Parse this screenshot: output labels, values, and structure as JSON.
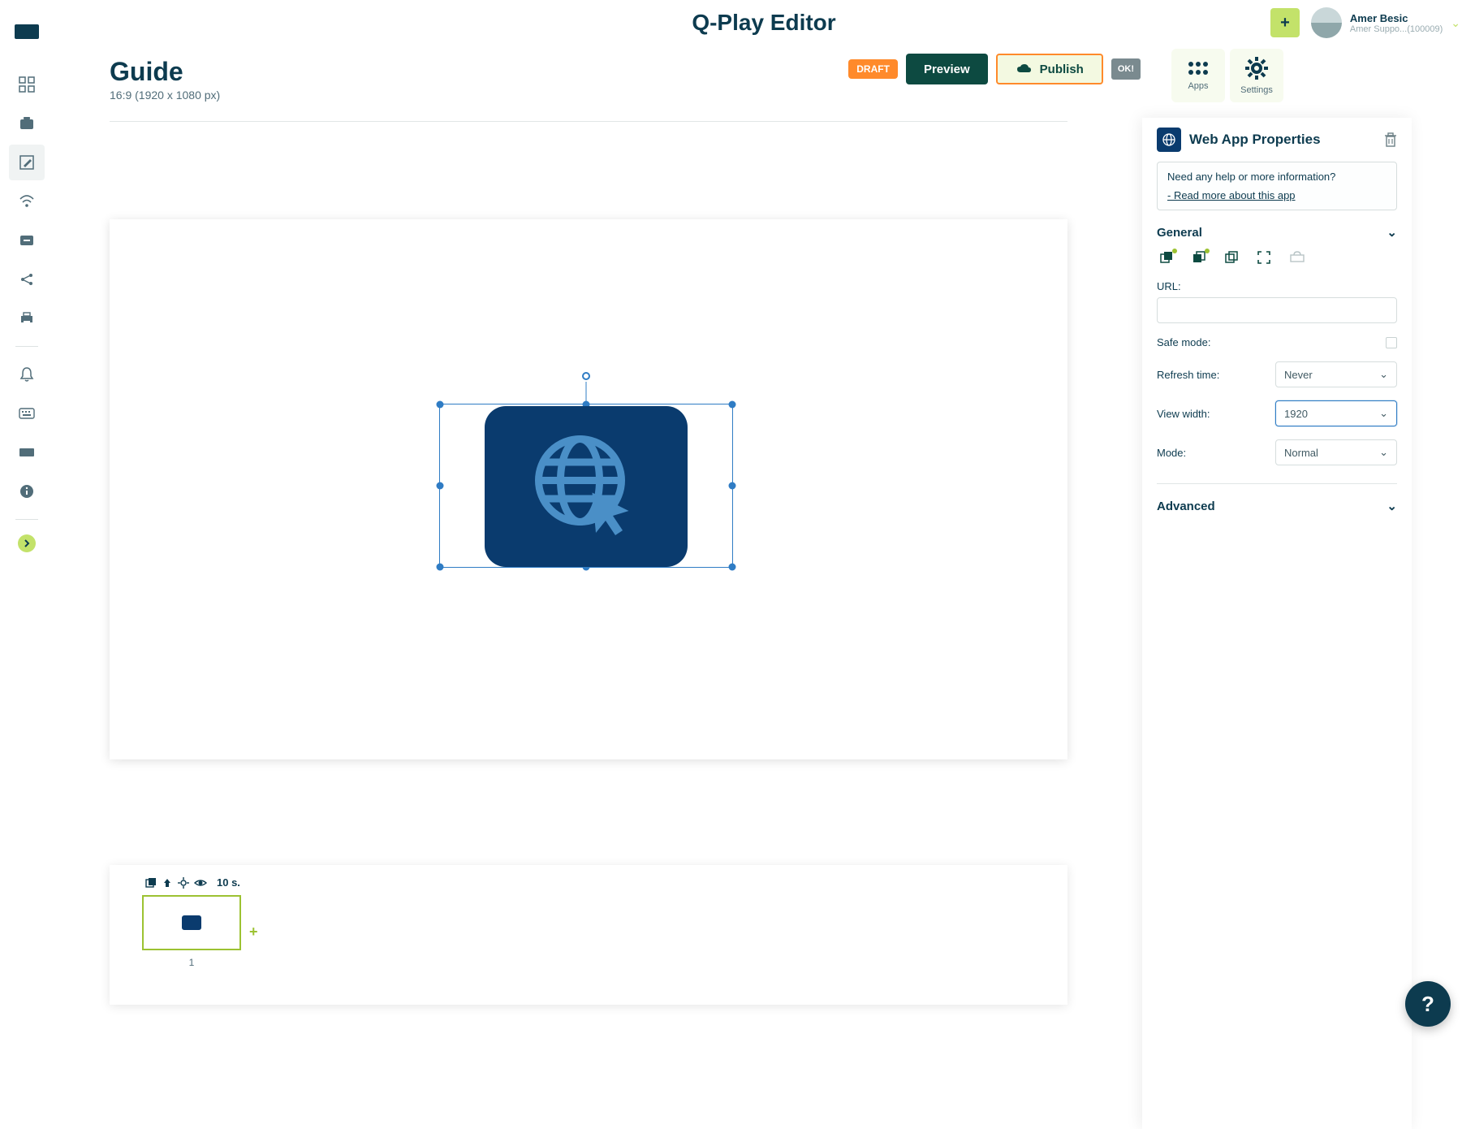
{
  "app_title": "Q-Play Editor",
  "user": {
    "name": "Amer Besic",
    "sub": "Amer Suppo...(100009)"
  },
  "page": {
    "title": "Guide",
    "subtitle": "16:9 (1920 x 1080 px)"
  },
  "status_badge": "DRAFT",
  "buttons": {
    "preview": "Preview",
    "publish": "Publish",
    "ok": "OK!"
  },
  "tabs": {
    "apps": "Apps",
    "settings": "Settings"
  },
  "timeline": {
    "duration": "10 s.",
    "slide_number": "1"
  },
  "panel": {
    "title": "Web App Properties",
    "help_question": "Need any help or more information?",
    "help_link": "- Read more about this app",
    "section_general": "General",
    "section_advanced": "Advanced",
    "labels": {
      "url": "URL:",
      "safe_mode": "Safe mode:",
      "refresh_time": "Refresh time:",
      "view_width": "View width:",
      "mode": "Mode:"
    },
    "values": {
      "url": "",
      "refresh_time": "Never",
      "view_width": "1920",
      "mode": "Normal"
    }
  },
  "help_fab": "?"
}
